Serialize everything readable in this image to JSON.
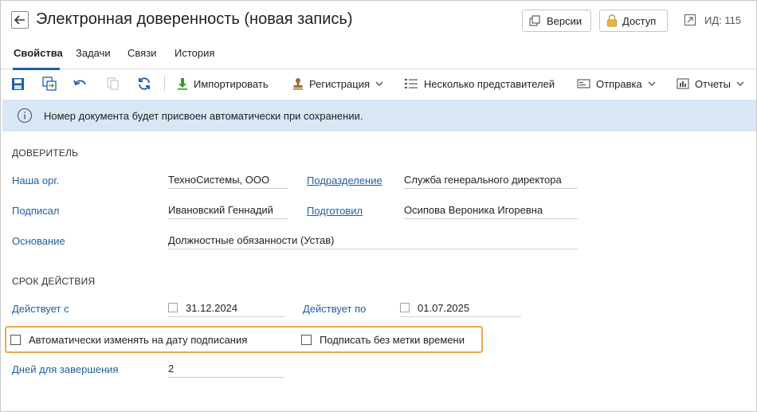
{
  "header": {
    "title": "Электронная доверенность (новая запись)",
    "versions_label": "Версии",
    "access_label": "Доступ",
    "id_label": "ИД: 115"
  },
  "tabs": [
    {
      "label": "Свойства",
      "active": true
    },
    {
      "label": "Задачи",
      "active": false
    },
    {
      "label": "Связи",
      "active": false
    },
    {
      "label": "История",
      "active": false
    }
  ],
  "toolbar": {
    "import_label": "Импортировать",
    "registration_label": "Регистрация",
    "representatives_label": "Несколько представителей",
    "send_label": "Отправка",
    "reports_label": "Отчеты"
  },
  "banner": {
    "text": "Номер документа будет присвоен автоматически при сохранении."
  },
  "principal": {
    "section_title": "ДОВЕРИТЕЛЬ",
    "org_label": "Наша орг.",
    "org_value": "ТехноСистемы, ООО",
    "department_label": "Подразделение",
    "department_value": "Служба генерального директора",
    "signer_label": "Подписал",
    "signer_value": "Ивановский Геннадий",
    "prepared_label": "Подготовил",
    "prepared_value": "Осипова Вероника Игоревна",
    "basis_label": "Основание",
    "basis_value": "Должностные обязанности (Устав)"
  },
  "validity": {
    "section_title": "СРОК ДЕЙСТВИЯ",
    "from_label": "Действует с",
    "from_value": "31.12.2024",
    "to_label": "Действует по",
    "to_value": "01.07.2025",
    "auto_change_label": "Автоматически изменять на дату подписания",
    "auto_change_checked": false,
    "no_timestamp_label": "Подписать без метки времени",
    "no_timestamp_checked": false,
    "days_label": "Дней для завершения",
    "days_value": "2"
  },
  "colors": {
    "accent": "#1d5fa6",
    "link": "#1f5e9e",
    "banner_bg": "#d8e6f5",
    "highlight": "#f0a64e",
    "import_icon": "#3a9a2b",
    "registration_icon": "#9b6a3a"
  },
  "icons": {
    "back": "arrow-left-icon",
    "versions": "versions-icon",
    "access": "lock-icon",
    "id": "external-link-icon",
    "save": "save-icon",
    "save_close": "save-close-icon",
    "undo": "undo-icon",
    "copy": "copy-icon",
    "refresh": "refresh-icon",
    "import": "download-arrow-icon",
    "registration": "stamp-icon",
    "representatives": "list-icon",
    "send": "send-icon",
    "reports": "chart-icon",
    "info": "info-icon",
    "calendar": "calendar-icon"
  }
}
